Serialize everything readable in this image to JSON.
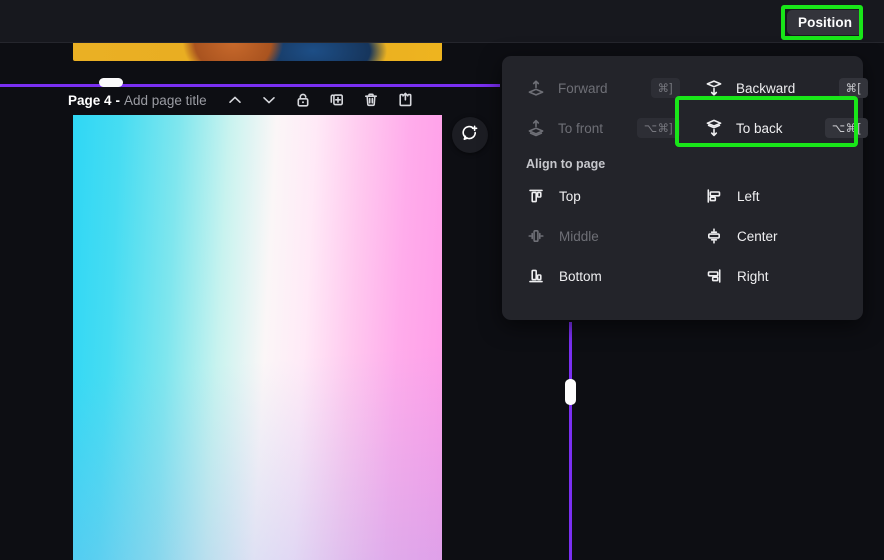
{
  "app": {
    "background_color": "#0d0e13",
    "accent_purple": "#7a2ff2",
    "highlight_green": "#19e619",
    "panel_bg": "#23242a"
  },
  "topbar": {
    "position_button_label": "Position",
    "position_button_highlighted": true
  },
  "page_strip": {
    "page_label": "Page 4",
    "separator": "-",
    "title_placeholder": "Add page title",
    "tools": [
      {
        "name": "move-page-up-icon",
        "label": "chevron-up"
      },
      {
        "name": "move-page-down-icon",
        "label": "chevron-down"
      },
      {
        "name": "lock-page-icon",
        "label": "lock"
      },
      {
        "name": "duplicate-page-icon",
        "label": "duplicate"
      },
      {
        "name": "delete-page-icon",
        "label": "trash"
      },
      {
        "name": "add-page-icon",
        "label": "add-page"
      }
    ]
  },
  "canvas": {
    "comment_button_icon": "add-comment-icon",
    "gradient_from": "#2fd7f5",
    "gradient_mid": "#fbf6f7",
    "gradient_to": "#ff9ce8"
  },
  "position_panel": {
    "layer_actions": [
      {
        "label": "Forward",
        "shortcut": "⌘]",
        "disabled": true,
        "icon": "bring-forward-icon"
      },
      {
        "label": "Backward",
        "shortcut": "⌘[",
        "disabled": false,
        "icon": "send-backward-icon"
      },
      {
        "label": "To front",
        "shortcut": "⌥⌘]",
        "disabled": true,
        "icon": "bring-to-front-icon"
      },
      {
        "label": "To back",
        "shortcut": "⌥⌘[",
        "disabled": false,
        "icon": "send-to-back-icon",
        "highlighted": true
      }
    ],
    "align_section_title": "Align to page",
    "align_actions": [
      {
        "label": "Top",
        "disabled": false,
        "icon": "align-top-icon"
      },
      {
        "label": "Left",
        "disabled": false,
        "icon": "align-left-icon"
      },
      {
        "label": "Middle",
        "disabled": true,
        "icon": "align-middle-icon"
      },
      {
        "label": "Center",
        "disabled": false,
        "icon": "align-center-icon"
      },
      {
        "label": "Bottom",
        "disabled": false,
        "icon": "align-bottom-icon"
      },
      {
        "label": "Right",
        "disabled": false,
        "icon": "align-right-icon"
      }
    ]
  }
}
